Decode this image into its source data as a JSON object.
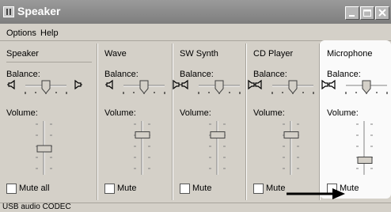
{
  "window": {
    "title": "Speaker"
  },
  "menu": [
    "Options",
    "Help"
  ],
  "labels": {
    "balance": "Balance:",
    "volume": "Volume:"
  },
  "columns": [
    {
      "name": "Speaker",
      "mute_label": "Mute all",
      "muted": false,
      "balance_fraction": 0.5,
      "volume_fraction": 0.5
    },
    {
      "name": "Wave",
      "mute_label": "Mute",
      "muted": false,
      "balance_fraction": 0.5,
      "volume_fraction": 0.8
    },
    {
      "name": "SW Synth",
      "mute_label": "Mute",
      "muted": false,
      "balance_fraction": 0.5,
      "volume_fraction": 0.8
    },
    {
      "name": "CD Player",
      "mute_label": "Mute",
      "muted": false,
      "balance_fraction": 0.5,
      "volume_fraction": 0.8
    },
    {
      "name": "Microphone",
      "mute_label": "Mute",
      "muted": false,
      "balance_fraction": 0.5,
      "volume_fraction": 0.25
    }
  ],
  "status": "USB audio CODEC",
  "colors": {
    "titlebar": "#8a8a8a",
    "face": "#d4d0c8",
    "highlight_panel": "#fafafa",
    "annotation_arrow": "#000000"
  }
}
